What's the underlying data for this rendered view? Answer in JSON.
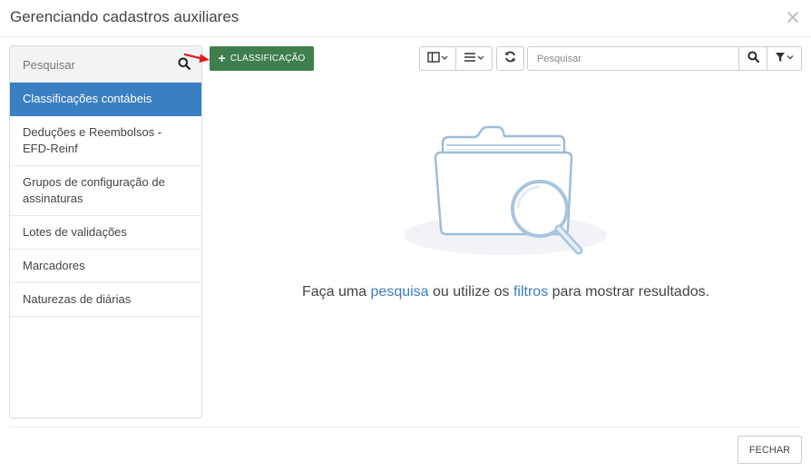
{
  "modal": {
    "title": "Gerenciando cadastros auxiliares",
    "close_icon": "close-icon"
  },
  "sidebar": {
    "search_placeholder": "Pesquisar",
    "search_icon": "search-icon",
    "items": [
      {
        "label": "Classificações contábeis",
        "active": true
      },
      {
        "label": "Deduções e Reembolsos - EFD-Reinf",
        "active": false
      },
      {
        "label": "Grupos de configuração de assinaturas",
        "active": false
      },
      {
        "label": "Lotes de validações",
        "active": false
      },
      {
        "label": "Marcadores",
        "active": false
      },
      {
        "label": "Naturezas de diárias",
        "active": false
      }
    ]
  },
  "toolbar": {
    "add_label": "CLASSIFICAÇÃO",
    "add_color": "#3f7f4e",
    "columns_icon": "columns-icon",
    "list_icon": "list-icon",
    "refresh_icon": "refresh-icon",
    "search_placeholder": "Pesquisar",
    "search_icon": "search-icon",
    "filter_icon": "filter-icon"
  },
  "empty_state": {
    "illustration": "folder-magnifier-icon",
    "text_before": "Faça uma ",
    "link_search": "pesquisa",
    "text_middle": " ou utilize os ",
    "link_filters": "filtros",
    "text_after": " para mostrar resultados."
  },
  "footer": {
    "close_label": "FECHAR"
  },
  "colors": {
    "accent": "#3a7fc1",
    "primary_green": "#3f7f4e",
    "annotation_arrow": "#e0201f"
  }
}
